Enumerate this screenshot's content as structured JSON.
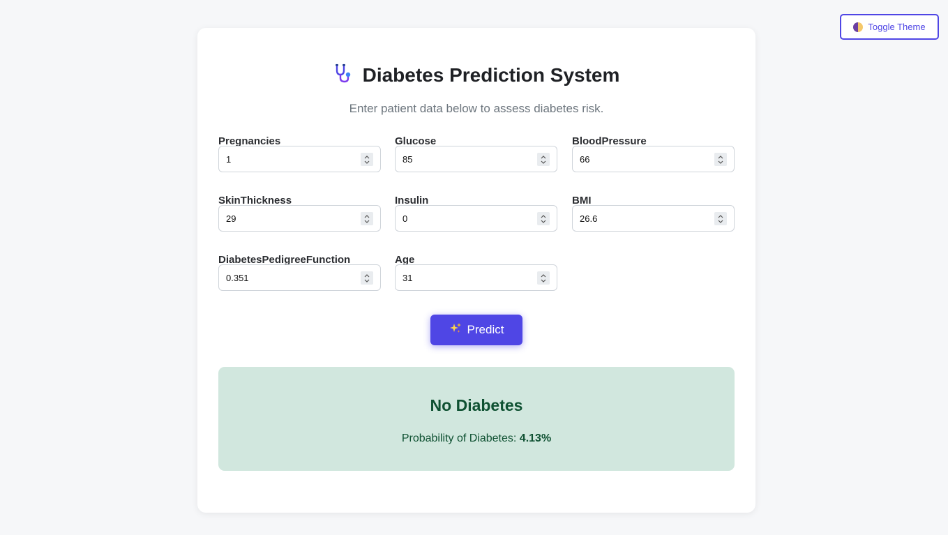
{
  "theme_toggle": {
    "label": "Toggle Theme",
    "icon": "moon-icon"
  },
  "header": {
    "title": "Diabetes Prediction System",
    "icon": "stethoscope-icon",
    "subtitle": "Enter patient data below to assess diabetes risk."
  },
  "fields": [
    {
      "label": "Pregnancies",
      "value": "1"
    },
    {
      "label": "Glucose",
      "value": "85"
    },
    {
      "label": "BloodPressure",
      "value": "66"
    },
    {
      "label": "SkinThickness",
      "value": "29"
    },
    {
      "label": "Insulin",
      "value": "0"
    },
    {
      "label": "BMI",
      "value": "26.6"
    },
    {
      "label": "DiabetesPedigreeFunction",
      "value": "0.351"
    },
    {
      "label": "Age",
      "value": "31"
    }
  ],
  "predict_button": {
    "label": "Predict",
    "icon": "sparkles-icon"
  },
  "result": {
    "heading": "No Diabetes",
    "probability_label": "Probability of Diabetes:",
    "probability_value": "4.13%"
  },
  "colors": {
    "accent": "#4f46e5",
    "result_bg": "#d1e7de",
    "result_text": "#0f5132"
  }
}
